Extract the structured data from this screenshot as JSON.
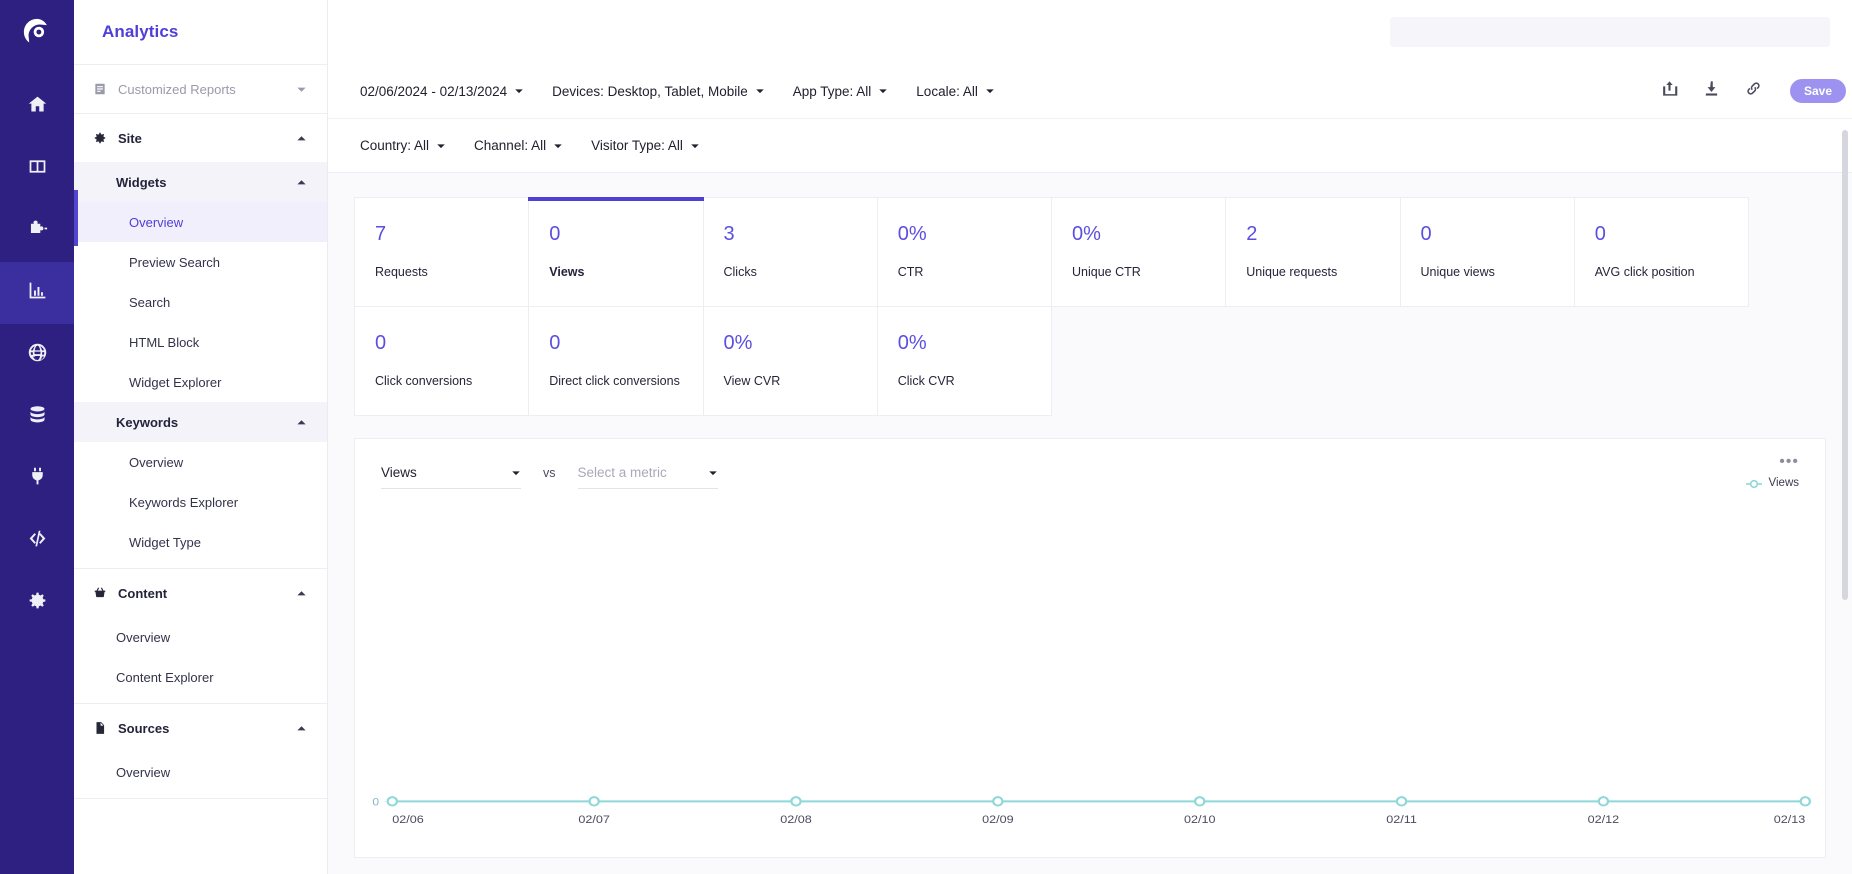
{
  "rail": {
    "logo_icon": "brand-logo-icon",
    "items": [
      {
        "icon": "home-icon",
        "name": "home",
        "active": false
      },
      {
        "icon": "layout-columns-icon",
        "name": "layout",
        "active": false
      },
      {
        "icon": "puzzle-piece-icon",
        "name": "integrations",
        "active": false
      },
      {
        "icon": "bar-chart-icon",
        "name": "analytics",
        "active": true
      },
      {
        "icon": "globe-icon",
        "name": "globe",
        "active": false
      },
      {
        "icon": "database-icon",
        "name": "database",
        "active": false
      },
      {
        "icon": "plug-icon",
        "name": "plugins",
        "active": false
      },
      {
        "icon": "code-icon",
        "name": "developer",
        "active": false
      },
      {
        "icon": "gear-icon",
        "name": "settings",
        "active": false
      }
    ]
  },
  "sidebar": {
    "brand": "Analytics",
    "customized_reports": {
      "label": "Customized Reports",
      "icon": "report-icon",
      "chevron": "chevron-down-icon"
    },
    "groups": [
      {
        "label": "Site",
        "icon": "gear-icon",
        "chevron": "chevron-up-icon",
        "subsections": [
          {
            "label": "Widgets",
            "chevron": "chevron-up-icon",
            "items": [
              {
                "label": "Overview",
                "active": true
              },
              {
                "label": "Preview Search",
                "active": false
              },
              {
                "label": "Search",
                "active": false
              },
              {
                "label": "HTML Block",
                "active": false
              },
              {
                "label": "Widget Explorer",
                "active": false
              }
            ]
          },
          {
            "label": "Keywords",
            "chevron": "chevron-up-icon",
            "items": [
              {
                "label": "Overview",
                "active": false
              },
              {
                "label": "Keywords Explorer",
                "active": false
              },
              {
                "label": "Widget Type",
                "active": false
              }
            ]
          }
        ]
      },
      {
        "label": "Content",
        "icon": "basket-icon",
        "chevron": "chevron-up-icon",
        "items": [
          {
            "label": "Overview",
            "active": false
          },
          {
            "label": "Content Explorer",
            "active": false
          }
        ]
      },
      {
        "label": "Sources",
        "icon": "document-icon",
        "chevron": "chevron-up-icon",
        "items": [
          {
            "label": "Overview",
            "active": false
          }
        ]
      }
    ]
  },
  "filters": {
    "row1": [
      {
        "label": "02/06/2024 - 02/13/2024",
        "name": "date-range-filter"
      },
      {
        "label": "Devices: Desktop, Tablet, Mobile",
        "name": "devices-filter"
      },
      {
        "label": "App Type: All",
        "name": "app-type-filter"
      },
      {
        "label": "Locale: All",
        "name": "locale-filter"
      }
    ],
    "row2": [
      {
        "label": "Country: All",
        "name": "country-filter"
      },
      {
        "label": "Channel: All",
        "name": "channel-filter"
      },
      {
        "label": "Visitor Type: All",
        "name": "visitor-type-filter"
      }
    ],
    "tools": [
      {
        "icon": "share-icon",
        "name": "share-button"
      },
      {
        "icon": "download-icon",
        "name": "download-button"
      },
      {
        "icon": "link-icon",
        "name": "copy-link-button"
      }
    ],
    "save_label": "Save"
  },
  "stats": {
    "row1": [
      {
        "value": "7",
        "label": "Requests",
        "selected": false
      },
      {
        "value": "0",
        "label": "Views",
        "selected": true
      },
      {
        "value": "3",
        "label": "Clicks",
        "selected": false
      },
      {
        "value": "0%",
        "label": "CTR",
        "selected": false
      },
      {
        "value": "0%",
        "label": "Unique CTR",
        "selected": false
      },
      {
        "value": "2",
        "label": "Unique requests",
        "selected": false
      },
      {
        "value": "0",
        "label": "Unique views",
        "selected": false
      },
      {
        "value": "0",
        "label": "AVG click position",
        "selected": false
      }
    ],
    "row2": [
      {
        "value": "0",
        "label": "Click conversions",
        "selected": false
      },
      {
        "value": "0",
        "label": "Direct click conversions",
        "selected": false
      },
      {
        "value": "0%",
        "label": "View CVR",
        "selected": false
      },
      {
        "value": "0%",
        "label": "Click CVR",
        "selected": false
      }
    ]
  },
  "chart_controls": {
    "primary_metric": "Views",
    "vs_label": "vs",
    "secondary_metric_placeholder": "Select a metric",
    "kebab_label": "•••"
  },
  "chart_data": {
    "type": "line",
    "title": "",
    "xlabel": "",
    "ylabel": "",
    "categories": [
      "02/06",
      "02/07",
      "02/08",
      "02/09",
      "02/10",
      "02/11",
      "02/12",
      "02/13"
    ],
    "series": [
      {
        "name": "Views",
        "values": [
          0,
          0,
          0,
          0,
          0,
          0,
          0,
          0
        ],
        "color": "#8ed8d8"
      }
    ],
    "ytick_labels": [
      "0"
    ],
    "ylim": [
      0,
      1
    ],
    "grid": false,
    "legend_position": "top-right",
    "legend": [
      "Views"
    ]
  },
  "colors": {
    "accent": "#4f3fd8",
    "rail_bg": "#2d2080",
    "rail_active": "#3b2fa0",
    "stat_value": "#5b4fe0",
    "line": "#8ed8d8",
    "save_bg": "#9d92ef"
  }
}
